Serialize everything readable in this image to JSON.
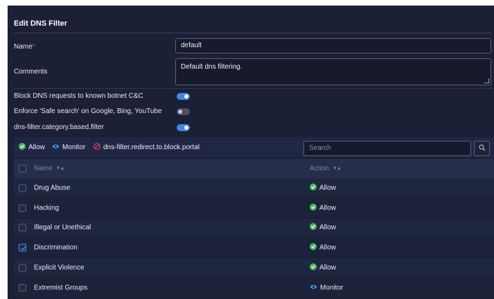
{
  "panel": {
    "title": "Edit DNS Filter"
  },
  "form": {
    "name_label": "Name",
    "required_marker": "*",
    "name_value": "default",
    "comments_label": "Comments",
    "comments_value": "Default dns filtering.",
    "block_botnet_label": "Block DNS requests to known botnet C&C",
    "block_botnet_on": true,
    "safe_search_label": "Enforce 'Safe search' on Google, Bing, YouTube",
    "safe_search_on": false,
    "category_filter_label": "dns-filter.category.based.filter",
    "category_filter_on": true
  },
  "toolbar": {
    "allow_label": "Allow",
    "monitor_label": "Monitor",
    "redirect_label": "dns-filter.redirect.to.block.portal",
    "search_placeholder": "Search"
  },
  "table": {
    "columns": {
      "name": "Name",
      "action": "Action"
    },
    "rows": [
      {
        "name": "Drug Abuse",
        "action": "Allow",
        "checked": false
      },
      {
        "name": "Hacking",
        "action": "Allow",
        "checked": false
      },
      {
        "name": "Illegal or Unethical",
        "action": "Allow",
        "checked": false
      },
      {
        "name": "Discrimination",
        "action": "Allow",
        "checked": true
      },
      {
        "name": "Explicit Violence",
        "action": "Allow",
        "checked": false
      },
      {
        "name": "Extremist Groups",
        "action": "Monitor",
        "checked": false
      }
    ]
  },
  "colors": {
    "allow": "#4cb85c",
    "monitor": "#3aa3e3",
    "redirect": "#e0454f",
    "toggle_on": "#3f86e8"
  },
  "icons": {
    "allow": "check-circle-icon",
    "monitor": "eye-icon",
    "redirect": "block-icon",
    "search": "search-icon",
    "sort": "sort-icon"
  }
}
